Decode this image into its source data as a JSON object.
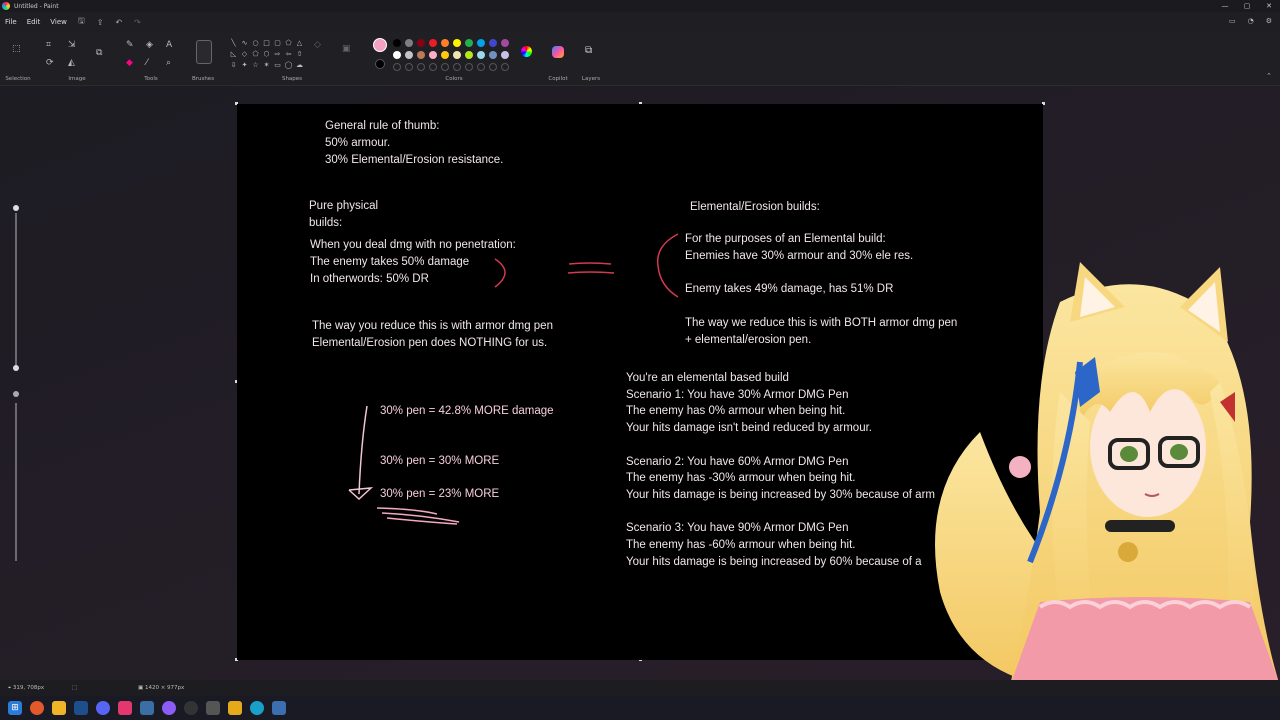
{
  "window": {
    "title": "Untitled - Paint",
    "controls": [
      "—",
      "▢",
      "✕"
    ]
  },
  "menu": {
    "items": [
      "File",
      "Edit",
      "View"
    ]
  },
  "ribbon": {
    "groups": [
      "Selection",
      "Image",
      "Tools",
      "Brushes",
      "Shapes",
      "Colors",
      "Copilot",
      "Layers"
    ],
    "current_color": "#f4a0c0",
    "secondary_color": "#000000",
    "palette": [
      "#000000",
      "#7f7f7f",
      "#880015",
      "#ed1c24",
      "#ff7f27",
      "#fff200",
      "#22b14c",
      "#00a2e8",
      "#3f48cc",
      "#a349a4",
      "#ffffff",
      "#c3c3c3",
      "#b97a57",
      "#ffaec9",
      "#ffc90e",
      "#efe4b0",
      "#b5e61d",
      "#99d9ea",
      "#7092be",
      "#c8bfe7"
    ]
  },
  "canvas": {
    "rule": [
      "General rule of thumb:",
      "50% armour.",
      "30% Elemental/Erosion resistance."
    ],
    "physical_title": [
      "Pure physical",
      "builds:"
    ],
    "physical_desc": [
      "When you deal dmg with no penetration:",
      "The enemy takes 50% damage",
      "In otherwords: 50% DR"
    ],
    "physical_reduce": [
      "The way you reduce this is with armor dmg pen",
      "Elemental/Erosion pen does NOTHING for us."
    ],
    "pen_lines": [
      "30% pen = 42.8% MORE damage",
      "30% pen = 30% MORE",
      "30% pen = 23% MORE"
    ],
    "elemental_title": "Elemental/Erosion builds:",
    "elemental_desc": [
      "For the purposes of an Elemental build:",
      "Enemies have 30% armour and 30% ele res."
    ],
    "elemental_damage": "Enemy takes 49% damage, has 51% DR",
    "elemental_reduce": [
      "The way we reduce this is with BOTH armor dmg pen",
      "+ elemental/erosion pen."
    ],
    "scenarios": [
      "You're an elemental based build",
      "Scenario 1: You have 30% Armor DMG Pen",
      "The enemy has 0% armour when being hit.",
      "Your hits damage isn't beind reduced by armour.",
      "",
      "Scenario 2: You have 60% Armor DMG Pen",
      "The enemy has -30% armour when being hit.",
      "Your hits damage is being increased by 30% because of arm",
      "",
      "Scenario 3: You have 90% Armor DMG Pen",
      "The enemy has -60% armour when being hit.",
      "Your hits damage is being increased by 60% because of a"
    ]
  },
  "status": {
    "cursor": "319, 708px",
    "canvas_size": "1420 × 977px"
  }
}
